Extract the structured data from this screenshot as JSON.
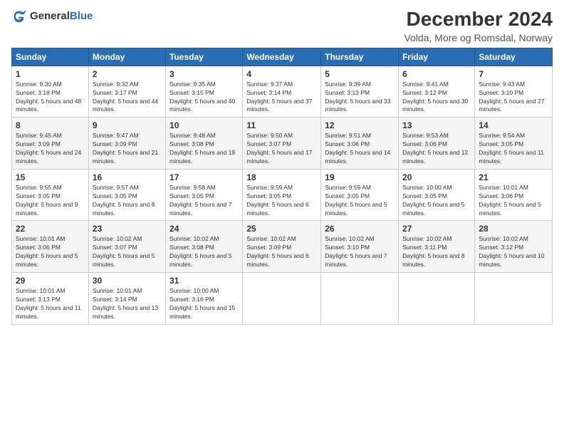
{
  "header": {
    "logo_general": "General",
    "logo_blue": "Blue",
    "title": "December 2024",
    "subtitle": "Volda, More og Romsdal, Norway"
  },
  "calendar": {
    "days_of_week": [
      "Sunday",
      "Monday",
      "Tuesday",
      "Wednesday",
      "Thursday",
      "Friday",
      "Saturday"
    ],
    "weeks": [
      [
        {
          "day": "1",
          "sunrise": "Sunrise: 9:30 AM",
          "sunset": "Sunset: 3:18 PM",
          "daylight": "Daylight: 5 hours and 48 minutes."
        },
        {
          "day": "2",
          "sunrise": "Sunrise: 9:32 AM",
          "sunset": "Sunset: 3:17 PM",
          "daylight": "Daylight: 5 hours and 44 minutes."
        },
        {
          "day": "3",
          "sunrise": "Sunrise: 9:35 AM",
          "sunset": "Sunset: 3:15 PM",
          "daylight": "Daylight: 5 hours and 40 minutes."
        },
        {
          "day": "4",
          "sunrise": "Sunrise: 9:37 AM",
          "sunset": "Sunset: 3:14 PM",
          "daylight": "Daylight: 5 hours and 37 minutes."
        },
        {
          "day": "5",
          "sunrise": "Sunrise: 9:39 AM",
          "sunset": "Sunset: 3:13 PM",
          "daylight": "Daylight: 5 hours and 33 minutes."
        },
        {
          "day": "6",
          "sunrise": "Sunrise: 9:41 AM",
          "sunset": "Sunset: 3:12 PM",
          "daylight": "Daylight: 5 hours and 30 minutes."
        },
        {
          "day": "7",
          "sunrise": "Sunrise: 9:43 AM",
          "sunset": "Sunset: 3:10 PM",
          "daylight": "Daylight: 5 hours and 27 minutes."
        }
      ],
      [
        {
          "day": "8",
          "sunrise": "Sunrise: 9:45 AM",
          "sunset": "Sunset: 3:09 PM",
          "daylight": "Daylight: 5 hours and 24 minutes."
        },
        {
          "day": "9",
          "sunrise": "Sunrise: 9:47 AM",
          "sunset": "Sunset: 3:09 PM",
          "daylight": "Daylight: 5 hours and 21 minutes."
        },
        {
          "day": "10",
          "sunrise": "Sunrise: 9:48 AM",
          "sunset": "Sunset: 3:08 PM",
          "daylight": "Daylight: 5 hours and 19 minutes."
        },
        {
          "day": "11",
          "sunrise": "Sunrise: 9:50 AM",
          "sunset": "Sunset: 3:07 PM",
          "daylight": "Daylight: 5 hours and 17 minutes."
        },
        {
          "day": "12",
          "sunrise": "Sunrise: 9:51 AM",
          "sunset": "Sunset: 3:06 PM",
          "daylight": "Daylight: 5 hours and 14 minutes."
        },
        {
          "day": "13",
          "sunrise": "Sunrise: 9:53 AM",
          "sunset": "Sunset: 3:06 PM",
          "daylight": "Daylight: 5 hours and 12 minutes."
        },
        {
          "day": "14",
          "sunrise": "Sunrise: 9:54 AM",
          "sunset": "Sunset: 3:05 PM",
          "daylight": "Daylight: 5 hours and 11 minutes."
        }
      ],
      [
        {
          "day": "15",
          "sunrise": "Sunrise: 9:55 AM",
          "sunset": "Sunset: 3:05 PM",
          "daylight": "Daylight: 5 hours and 9 minutes."
        },
        {
          "day": "16",
          "sunrise": "Sunrise: 9:57 AM",
          "sunset": "Sunset: 3:05 PM",
          "daylight": "Daylight: 5 hours and 8 minutes."
        },
        {
          "day": "17",
          "sunrise": "Sunrise: 9:58 AM",
          "sunset": "Sunset: 3:05 PM",
          "daylight": "Daylight: 5 hours and 7 minutes."
        },
        {
          "day": "18",
          "sunrise": "Sunrise: 9:59 AM",
          "sunset": "Sunset: 3:05 PM",
          "daylight": "Daylight: 5 hours and 6 minutes."
        },
        {
          "day": "19",
          "sunrise": "Sunrise: 9:59 AM",
          "sunset": "Sunset: 3:05 PM",
          "daylight": "Daylight: 5 hours and 5 minutes."
        },
        {
          "day": "20",
          "sunrise": "Sunrise: 10:00 AM",
          "sunset": "Sunset: 3:05 PM",
          "daylight": "Daylight: 5 hours and 5 minutes."
        },
        {
          "day": "21",
          "sunrise": "Sunrise: 10:01 AM",
          "sunset": "Sunset: 3:06 PM",
          "daylight": "Daylight: 5 hours and 5 minutes."
        }
      ],
      [
        {
          "day": "22",
          "sunrise": "Sunrise: 10:01 AM",
          "sunset": "Sunset: 3:06 PM",
          "daylight": "Daylight: 5 hours and 5 minutes."
        },
        {
          "day": "23",
          "sunrise": "Sunrise: 10:02 AM",
          "sunset": "Sunset: 3:07 PM",
          "daylight": "Daylight: 5 hours and 5 minutes."
        },
        {
          "day": "24",
          "sunrise": "Sunrise: 10:02 AM",
          "sunset": "Sunset: 3:08 PM",
          "daylight": "Daylight: 5 hours and 5 minutes."
        },
        {
          "day": "25",
          "sunrise": "Sunrise: 10:02 AM",
          "sunset": "Sunset: 3:09 PM",
          "daylight": "Daylight: 5 hours and 6 minutes."
        },
        {
          "day": "26",
          "sunrise": "Sunrise: 10:02 AM",
          "sunset": "Sunset: 3:10 PM",
          "daylight": "Daylight: 5 hours and 7 minutes."
        },
        {
          "day": "27",
          "sunrise": "Sunrise: 10:02 AM",
          "sunset": "Sunset: 3:11 PM",
          "daylight": "Daylight: 5 hours and 8 minutes."
        },
        {
          "day": "28",
          "sunrise": "Sunrise: 10:02 AM",
          "sunset": "Sunset: 3:12 PM",
          "daylight": "Daylight: 5 hours and 10 minutes."
        }
      ],
      [
        {
          "day": "29",
          "sunrise": "Sunrise: 10:01 AM",
          "sunset": "Sunset: 3:13 PM",
          "daylight": "Daylight: 5 hours and 11 minutes."
        },
        {
          "day": "30",
          "sunrise": "Sunrise: 10:01 AM",
          "sunset": "Sunset: 3:14 PM",
          "daylight": "Daylight: 5 hours and 13 minutes."
        },
        {
          "day": "31",
          "sunrise": "Sunrise: 10:00 AM",
          "sunset": "Sunset: 3:16 PM",
          "daylight": "Daylight: 5 hours and 15 minutes."
        },
        null,
        null,
        null,
        null
      ]
    ]
  }
}
